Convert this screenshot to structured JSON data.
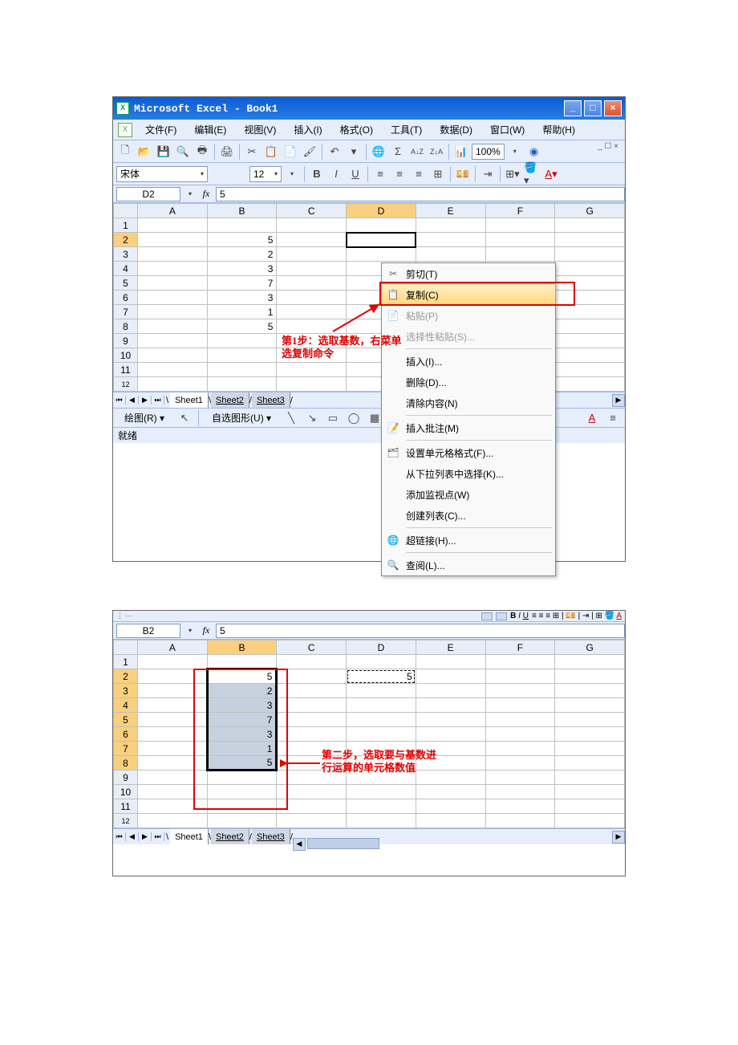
{
  "window": {
    "title": "Microsoft Excel - Book1",
    "icon": "X"
  },
  "menu": {
    "file": "文件(F)",
    "edit": "编辑(E)",
    "view": "视图(V)",
    "insert": "插入(I)",
    "format": "格式(O)",
    "tools": "工具(T)",
    "data": "数据(D)",
    "window": "窗口(W)",
    "help": "帮助(H)"
  },
  "toolbar": {
    "font_name": "宋体",
    "font_size": "12",
    "zoom": "100%"
  },
  "screenshot1": {
    "name_box": "D2",
    "formula": "5",
    "columns": [
      "A",
      "B",
      "C",
      "D",
      "E",
      "F",
      "G"
    ],
    "rows": [
      "1",
      "2",
      "3",
      "4",
      "5",
      "6",
      "7",
      "8",
      "9",
      "10",
      "11"
    ],
    "active_col": "D",
    "active_row": "2",
    "data_b": {
      "2": "5",
      "3": "2",
      "4": "3",
      "5": "7",
      "6": "3",
      "7": "1",
      "8": "5"
    },
    "annotation": "第1步：选取基数，右菜单\n选复制命令"
  },
  "context_menu": {
    "cut": "剪切(T)",
    "copy": "复制(C)",
    "paste": "粘贴(P)",
    "paste_special": "选择性粘贴(S)...",
    "insert": "插入(I)...",
    "delete": "删除(D)...",
    "clear": "清除内容(N)",
    "insert_comment": "插入批注(M)",
    "format_cells": "设置单元格格式(F)...",
    "pick_list": "从下拉列表中选择(K)...",
    "add_watch": "添加监视点(W)",
    "create_list": "创建列表(C)...",
    "hyperlink": "超链接(H)...",
    "lookup": "查阅(L)..."
  },
  "sheets": {
    "s1": "Sheet1",
    "s2": "Sheet2",
    "s3": "Sheet3"
  },
  "drawing": {
    "label": "绘图(R)",
    "autoshapes": "自选图形(U)"
  },
  "status": {
    "ready": "就绪"
  },
  "screenshot2": {
    "name_box": "B2",
    "formula": "5",
    "columns": [
      "A",
      "B",
      "C",
      "D",
      "E",
      "F",
      "G"
    ],
    "rows": [
      "1",
      "2",
      "3",
      "4",
      "5",
      "6",
      "7",
      "8",
      "9",
      "10",
      "11"
    ],
    "active_col": "B",
    "data_b": {
      "2": "5",
      "3": "2",
      "4": "3",
      "5": "7",
      "6": "3",
      "7": "1",
      "8": "5"
    },
    "marquee_d2": "5",
    "annotation": "第二步，选取要与基数进\n行运算的单元格数值"
  }
}
